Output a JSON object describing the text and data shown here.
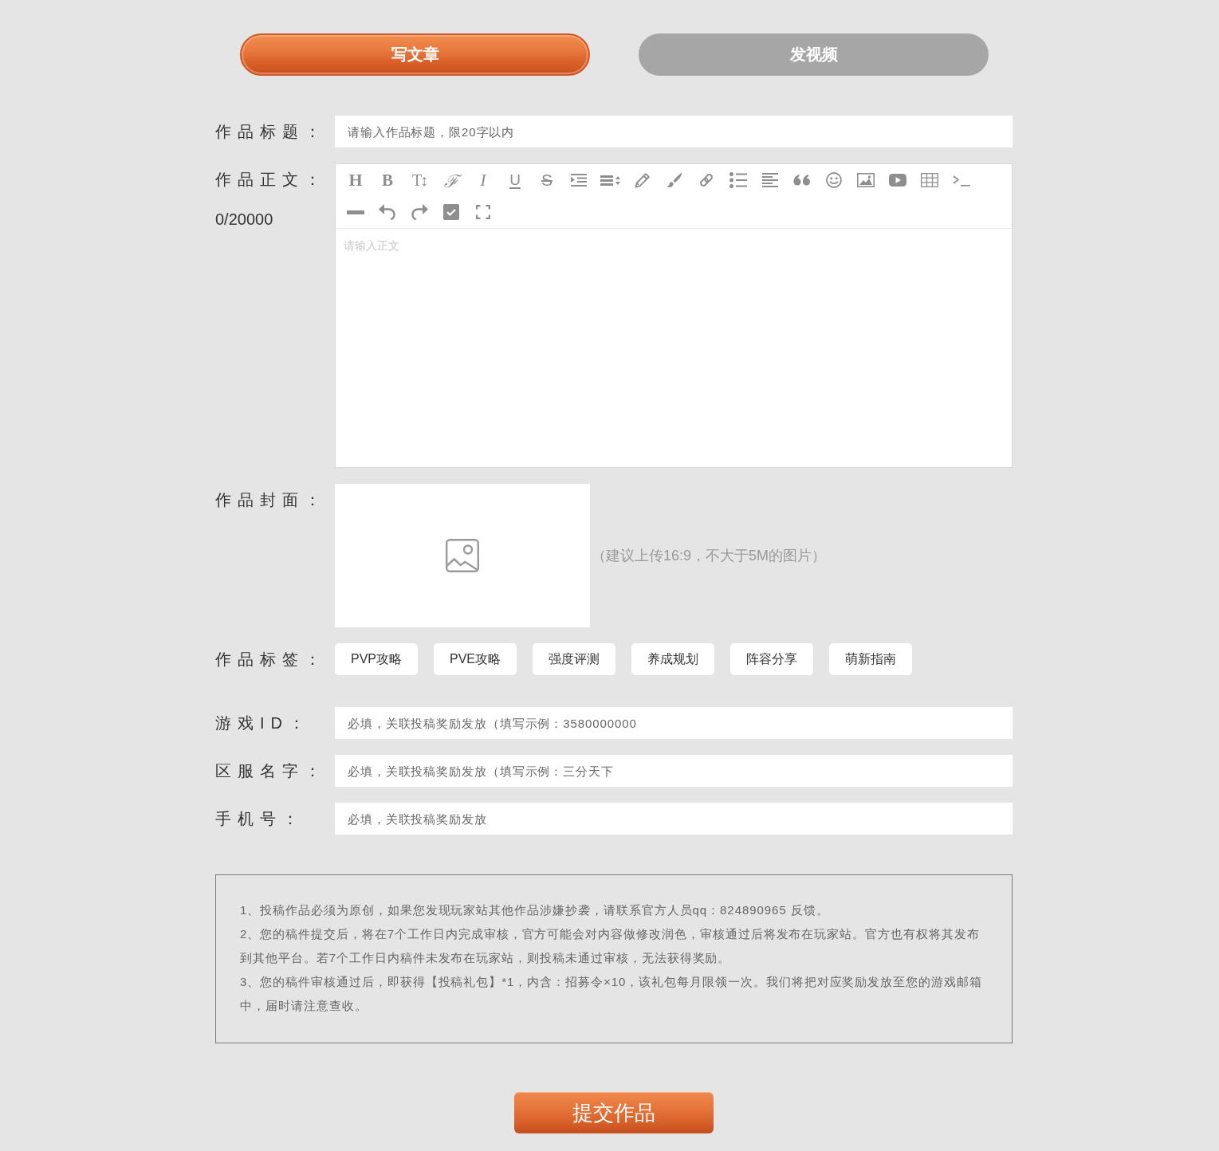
{
  "tabs": [
    {
      "label": "写文章",
      "selected": true
    },
    {
      "label": "发视频",
      "selected": false
    }
  ],
  "title_field": {
    "label": "作品标题：",
    "placeholder": "请输入作品标题，限20字以内"
  },
  "body_editor": {
    "label": "作品正文：",
    "counter": "0/20000",
    "toolbar": [
      {
        "kind": "heading",
        "text": "H"
      },
      {
        "kind": "bold",
        "text": "B"
      },
      {
        "kind": "size",
        "text": "T↕"
      },
      {
        "kind": "font",
        "text": "ℱ"
      },
      {
        "kind": "italic",
        "text": "I"
      },
      {
        "kind": "underline",
        "text": "U"
      },
      {
        "kind": "strike",
        "text": "S"
      },
      {
        "kind": "indent"
      },
      {
        "kind": "lineheight"
      },
      {
        "kind": "pencil"
      },
      {
        "kind": "brush"
      },
      {
        "kind": "link"
      },
      {
        "kind": "bullets"
      },
      {
        "kind": "align"
      },
      {
        "kind": "quote"
      },
      {
        "kind": "smiley"
      },
      {
        "kind": "image"
      },
      {
        "kind": "video"
      },
      {
        "kind": "table"
      },
      {
        "kind": "code"
      },
      {
        "kind": "rule"
      },
      {
        "kind": "undo"
      },
      {
        "kind": "redo"
      },
      {
        "kind": "checkbox"
      },
      {
        "kind": "fullscreen"
      }
    ],
    "placeholder": "请输入正文"
  },
  "cover": {
    "label": "作品封面：",
    "hint": "（建议上传16:9，不大于5M的图片）"
  },
  "tags": {
    "label": "作品标签：",
    "items": [
      {
        "label": "PVP攻略",
        "selected": false
      },
      {
        "label": "PVE攻略",
        "selected": false
      },
      {
        "label": "强度评测",
        "selected": false
      },
      {
        "label": "养成规划",
        "selected": false
      },
      {
        "label": "阵容分享",
        "selected": false
      },
      {
        "label": "萌新指南",
        "selected": false
      }
    ]
  },
  "fields": [
    {
      "label": "游戏ID：",
      "placeholder": "必填，关联投稿奖励发放（填写示例：3580000000"
    },
    {
      "label": "区服名字：",
      "placeholder": "必填，关联投稿奖励发放（填写示例：三分天下"
    },
    {
      "label": "手机号：",
      "placeholder": "必填，关联投稿奖励发放"
    }
  ],
  "notes": [
    "1、投稿作品必须为原创，如果您发现玩家站其他作品涉嫌抄袭，请联系官方人员qq：824890965 反馈。",
    "2、您的稿件提交后，将在7个工作日内完成审核，官方可能会对内容做修改润色，审核通过后将发布在玩家站。官方也有权将其发布到其他平台。若7个工作日内稿件未发布在玩家站，则投稿未通过审核，无法获得奖励。",
    "3、您的稿件审核通过后，即获得【投稿礼包】*1，内含：招募令×10，该礼包每月限领一次。我们将把对应奖励发放至您的游戏邮箱中，届时请注意查收。"
  ],
  "submit": {
    "label": "提交作品"
  }
}
